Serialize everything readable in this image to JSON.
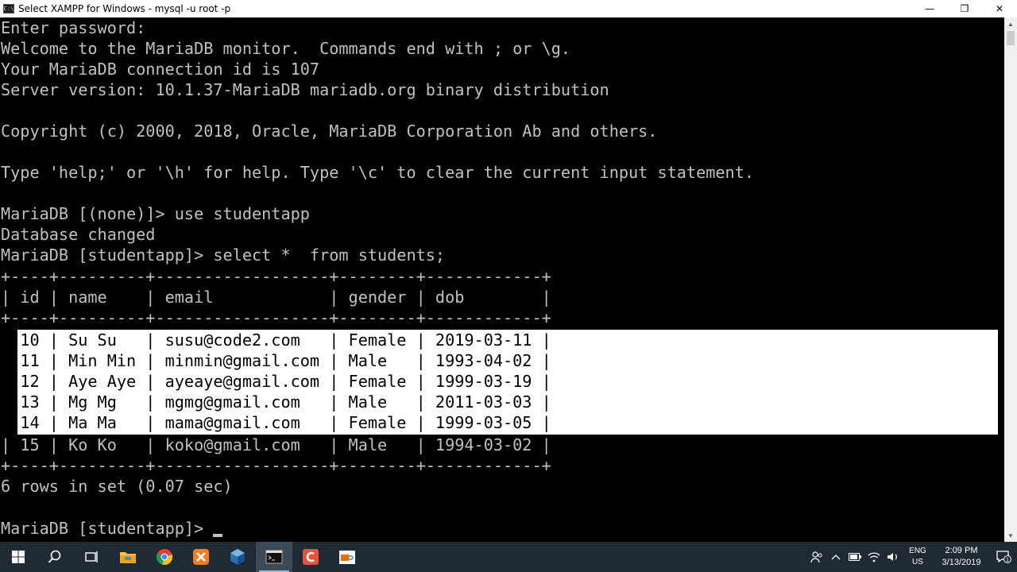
{
  "window": {
    "icon_label": "C:\\",
    "title": "Select XAMPP for Windows - mysql  -u root -p",
    "minimize": "—",
    "maximize": "❐",
    "close": "✕"
  },
  "console": {
    "lines": [
      "Enter password:",
      "Welcome to the MariaDB monitor.  Commands end with ; or \\g.",
      "Your MariaDB connection id is 107",
      "Server version: 10.1.37-MariaDB mariadb.org binary distribution",
      "",
      "Copyright (c) 2000, 2018, Oracle, MariaDB Corporation Ab and others.",
      "",
      "Type 'help;' or '\\h' for help. Type '\\c' to clear the current input statement.",
      "",
      "MariaDB [(none)]> use studentapp",
      "Database changed",
      "MariaDB [studentapp]> select *  from students;",
      "+----+---------+------------------+--------+------------+",
      "| id | name    | email            | gender | dob        |",
      "+----+---------+------------------+--------+------------+",
      "| 10 | Su Su   | susu@code2.com   | Female | 2019-03-11 |",
      "| 11 | Min Min | minmin@gmail.com | Male   | 1993-04-02 |",
      "| 12 | Aye Aye | ayeaye@gmail.com | Female | 1999-03-19 |",
      "| 13 | Mg Mg   | mgmg@gmail.com   | Male   | 2011-03-03 |",
      "| 14 | Ma Ma   | mama@gmail.com   | Female | 1999-03-05 |",
      "| 15 | Ko Ko   | koko@gmail.com   | Male   | 1994-03-02 |",
      "+----+---------+------------------+--------+------------+",
      "6 rows in set (0.07 sec)",
      "",
      "MariaDB [studentapp]> "
    ]
  },
  "taskbar": {
    "apps": [
      {
        "name": "start-button",
        "icon": "windows-logo-icon"
      },
      {
        "name": "search-button",
        "icon": "search-icon"
      },
      {
        "name": "task-view-button",
        "icon": "task-view-icon"
      },
      {
        "name": "file-explorer-button",
        "icon": "folder-icon"
      },
      {
        "name": "chrome-button",
        "icon": "chrome-icon"
      },
      {
        "name": "xampp-button",
        "icon": "xampp-icon"
      },
      {
        "name": "virtualbox-button",
        "icon": "cube-icon"
      },
      {
        "name": "terminal-button",
        "icon": "terminal-icon"
      },
      {
        "name": "editor-button",
        "icon": "c-editor-icon"
      },
      {
        "name": "java-button",
        "icon": "java-icon"
      }
    ],
    "lang_top": "ENG",
    "lang_bottom": "US",
    "time": "2:09 PM",
    "date": "3/13/2019",
    "notification_count": "1"
  }
}
